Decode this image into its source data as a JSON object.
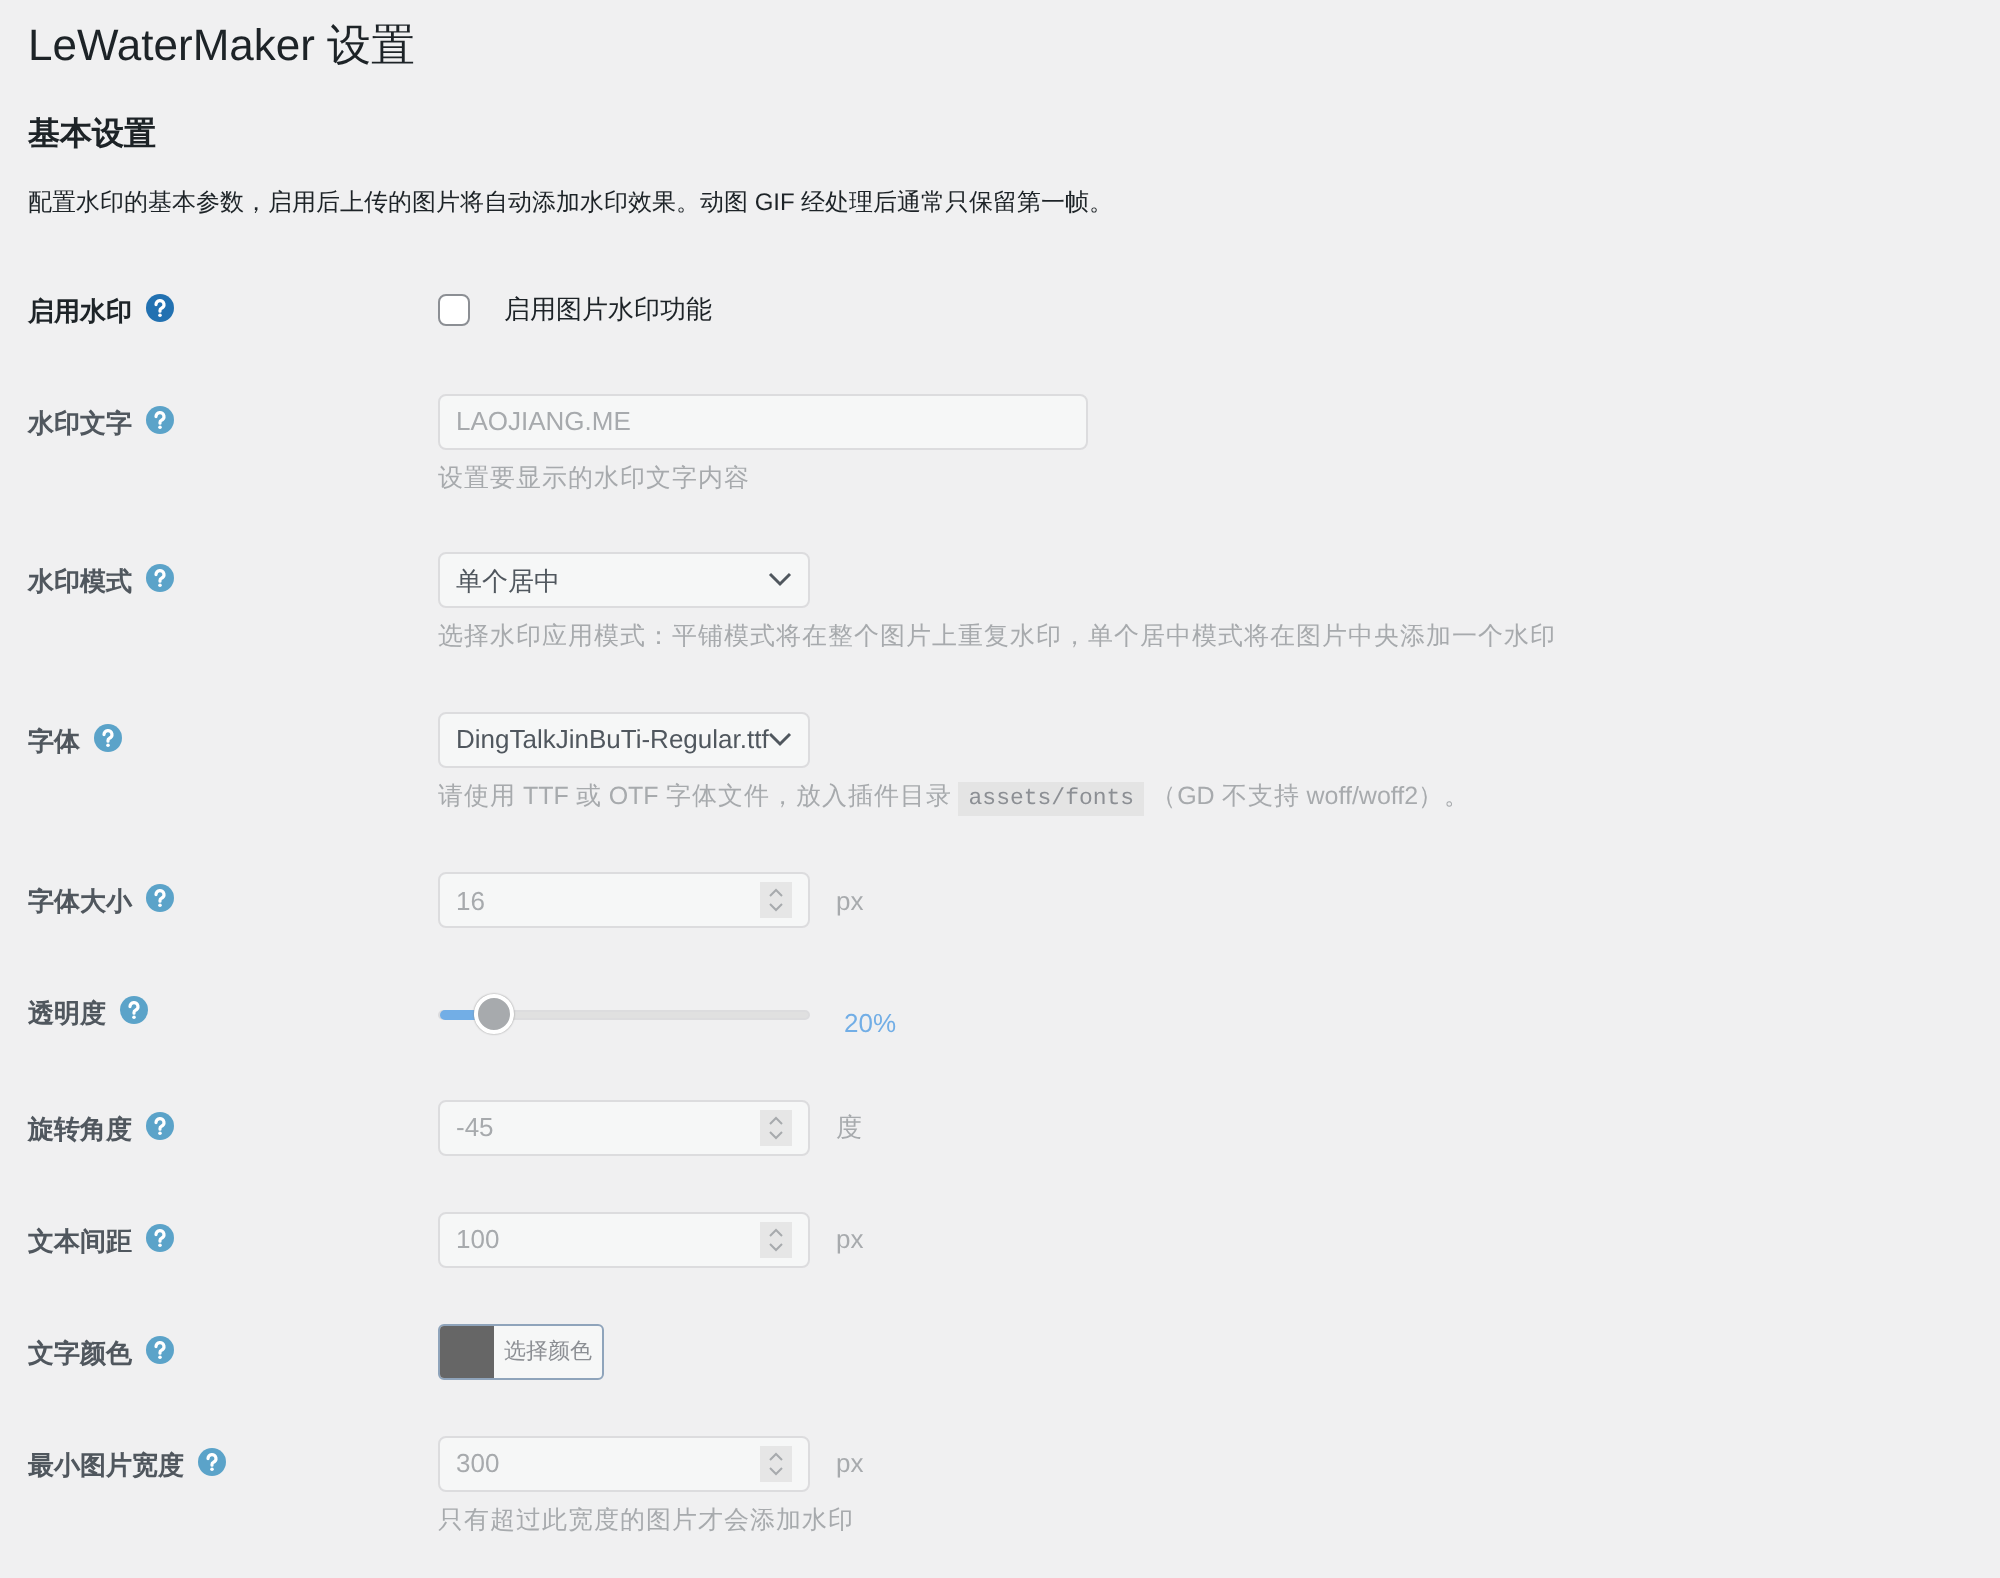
{
  "page_title": "LeWaterMaker 设置",
  "section": {
    "title": "基本设置",
    "description": "配置水印的基本参数，启用后上传的图片将自动添加水印效果。动图 GIF 经处理后通常只保留第一帧。"
  },
  "fields": [
    {
      "kind": "checkbox",
      "label": "启用水印",
      "disabled": false,
      "checked": false,
      "option_label": "启用图片水印功能"
    },
    {
      "kind": "text",
      "label": "水印文字",
      "disabled": true,
      "value": "LAOJIANG.ME",
      "help": [
        {
          "kind": "text",
          "text": "设置要显示的水印文字内容"
        }
      ]
    },
    {
      "kind": "select",
      "label": "水印模式",
      "disabled": true,
      "value": "单个居中",
      "help": [
        {
          "kind": "text",
          "text": "选择水印应用模式：平铺模式将在整个图片上重复水印，单个居中模式将在图片中央添加一个水印"
        }
      ]
    },
    {
      "kind": "select",
      "label": "字体",
      "disabled": true,
      "value": "DingTalkJinBuTi-Regular.ttf",
      "help": [
        {
          "kind": "text",
          "text": "请使用 TTF 或 OTF 字体文件，放入插件目录 "
        },
        {
          "kind": "code",
          "text": "assets/fonts"
        },
        {
          "kind": "text",
          "text": " （GD 不支持 woff/woff2）。"
        }
      ]
    },
    {
      "kind": "number",
      "label": "字体大小",
      "disabled": true,
      "value": "16",
      "unit": "px"
    },
    {
      "kind": "range",
      "label": "透明度",
      "disabled": true,
      "level": 0.1,
      "reading": "20%"
    },
    {
      "kind": "number",
      "label": "旋转角度",
      "disabled": true,
      "value": "-45",
      "unit": "度"
    },
    {
      "kind": "number",
      "label": "文本间距",
      "disabled": true,
      "value": "100",
      "unit": "px"
    },
    {
      "kind": "color",
      "label": "文字颜色",
      "disabled": true,
      "color": "#666666",
      "button_label": "选择颜色"
    },
    {
      "kind": "number",
      "label": "最小图片宽度",
      "disabled": true,
      "value": "300",
      "unit": "px",
      "help": [
        {
          "kind": "text",
          "text": "只有超过此宽度的图片才会添加水印"
        }
      ]
    }
  ]
}
